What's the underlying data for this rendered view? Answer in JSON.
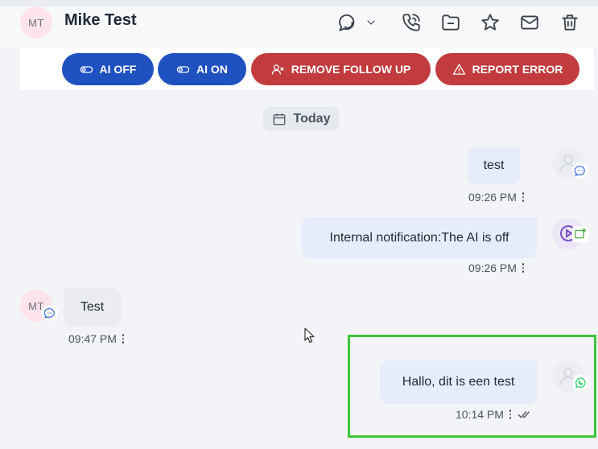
{
  "header": {
    "avatar_initials": "MT",
    "contact_name": "Mike Test",
    "icons": [
      "chat-bubbles-icon",
      "chevron-down-icon",
      "phone-icon",
      "folder-icon",
      "star-icon",
      "mail-icon",
      "trash-icon"
    ]
  },
  "toolbar": {
    "ai_off_label": "AI OFF",
    "ai_on_label": "AI ON",
    "remove_follow_up_label": "REMOVE FOLLOW UP",
    "report_error_label": "REPORT ERROR"
  },
  "colors": {
    "blue_button": "#1f51c1",
    "red_button": "#c23b3e",
    "outgoing_bubble": "#e6ecf9",
    "incoming_bubble": "#eaecef",
    "highlight": "#3ec43a",
    "whatsapp": "#25d366"
  },
  "date_separator": "Today",
  "messages": [
    {
      "direction": "outgoing",
      "text": "test",
      "time": "09:26 PM",
      "channel": "chat-icon"
    },
    {
      "direction": "outgoing",
      "text": "Internal notification:The AI is off",
      "time": "09:26 PM",
      "channel": "play-notification-icon"
    },
    {
      "direction": "incoming",
      "text": "Test",
      "time": "09:47 PM",
      "sender_initials": "MT",
      "channel": "chat-icon"
    },
    {
      "direction": "outgoing",
      "text": "Hallo, dit is een test",
      "time": "10:14 PM",
      "channel": "whatsapp-icon",
      "status": "read"
    }
  ]
}
